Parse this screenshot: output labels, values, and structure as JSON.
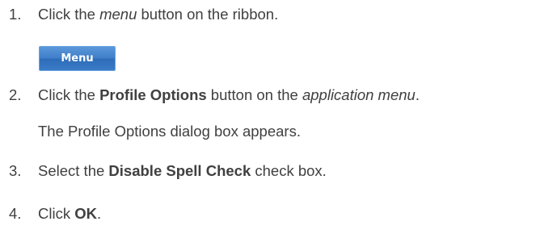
{
  "steps": [
    {
      "number": "1.",
      "pre": "Click the ",
      "emph": "menu",
      "post": " button on the ribbon."
    },
    {
      "number": "2.",
      "pre": "Click the ",
      "bold": "Profile Options",
      "mid": " button on the ",
      "emph": "application menu",
      "post": "."
    },
    {
      "number": "3.",
      "pre": "Select the ",
      "bold": "Disable Spell Check",
      "post": " check box."
    },
    {
      "number": "4.",
      "pre": "Click ",
      "bold": "OK",
      "post": "."
    }
  ],
  "menu_button_label": "Menu",
  "step2_note": "The Profile Options dialog box appears."
}
